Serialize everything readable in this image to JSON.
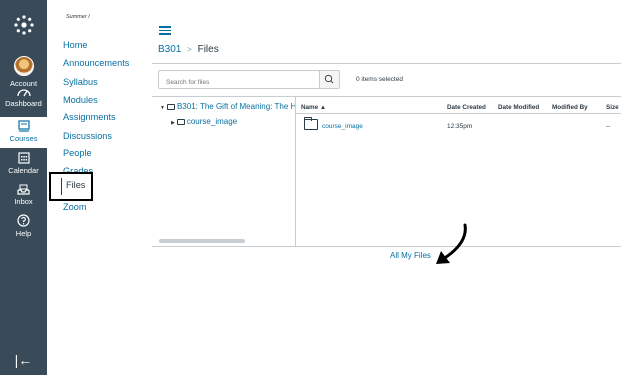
{
  "global_nav": {
    "account": "Account",
    "dashboard": "Dashboard",
    "courses": "Courses",
    "calendar": "Calendar",
    "inbox": "Inbox",
    "help": "Help",
    "collapse": "|←"
  },
  "course_nav": {
    "term": "Summer I",
    "items": [
      "Home",
      "Announcements",
      "Syllabus",
      "Modules",
      "Assignments",
      "Discussions",
      "People",
      "Grades",
      "Files",
      "Zoom"
    ],
    "active": "Files"
  },
  "breadcrumb": {
    "course": "B301",
    "separator": ">",
    "page": "Files"
  },
  "search": {
    "placeholder": "Search for files"
  },
  "selection": {
    "count_text": "0 items selected"
  },
  "tree": {
    "root": "B301: The Gift of Meaning: The H",
    "child": "course_image"
  },
  "table": {
    "headers": {
      "name": "Name ▲",
      "created": "Date Created",
      "modified": "Date Modified",
      "modified_by": "Modified By",
      "size": "Size"
    },
    "rows": [
      {
        "name": "course_image",
        "created": "12:35pm",
        "modified": "",
        "modified_by": "",
        "size": "--"
      }
    ]
  },
  "footer": {
    "all_files": "All My Files"
  },
  "colors": {
    "nav_bg": "#394b58",
    "link": "#0770a3",
    "text": "#2d3b45"
  }
}
